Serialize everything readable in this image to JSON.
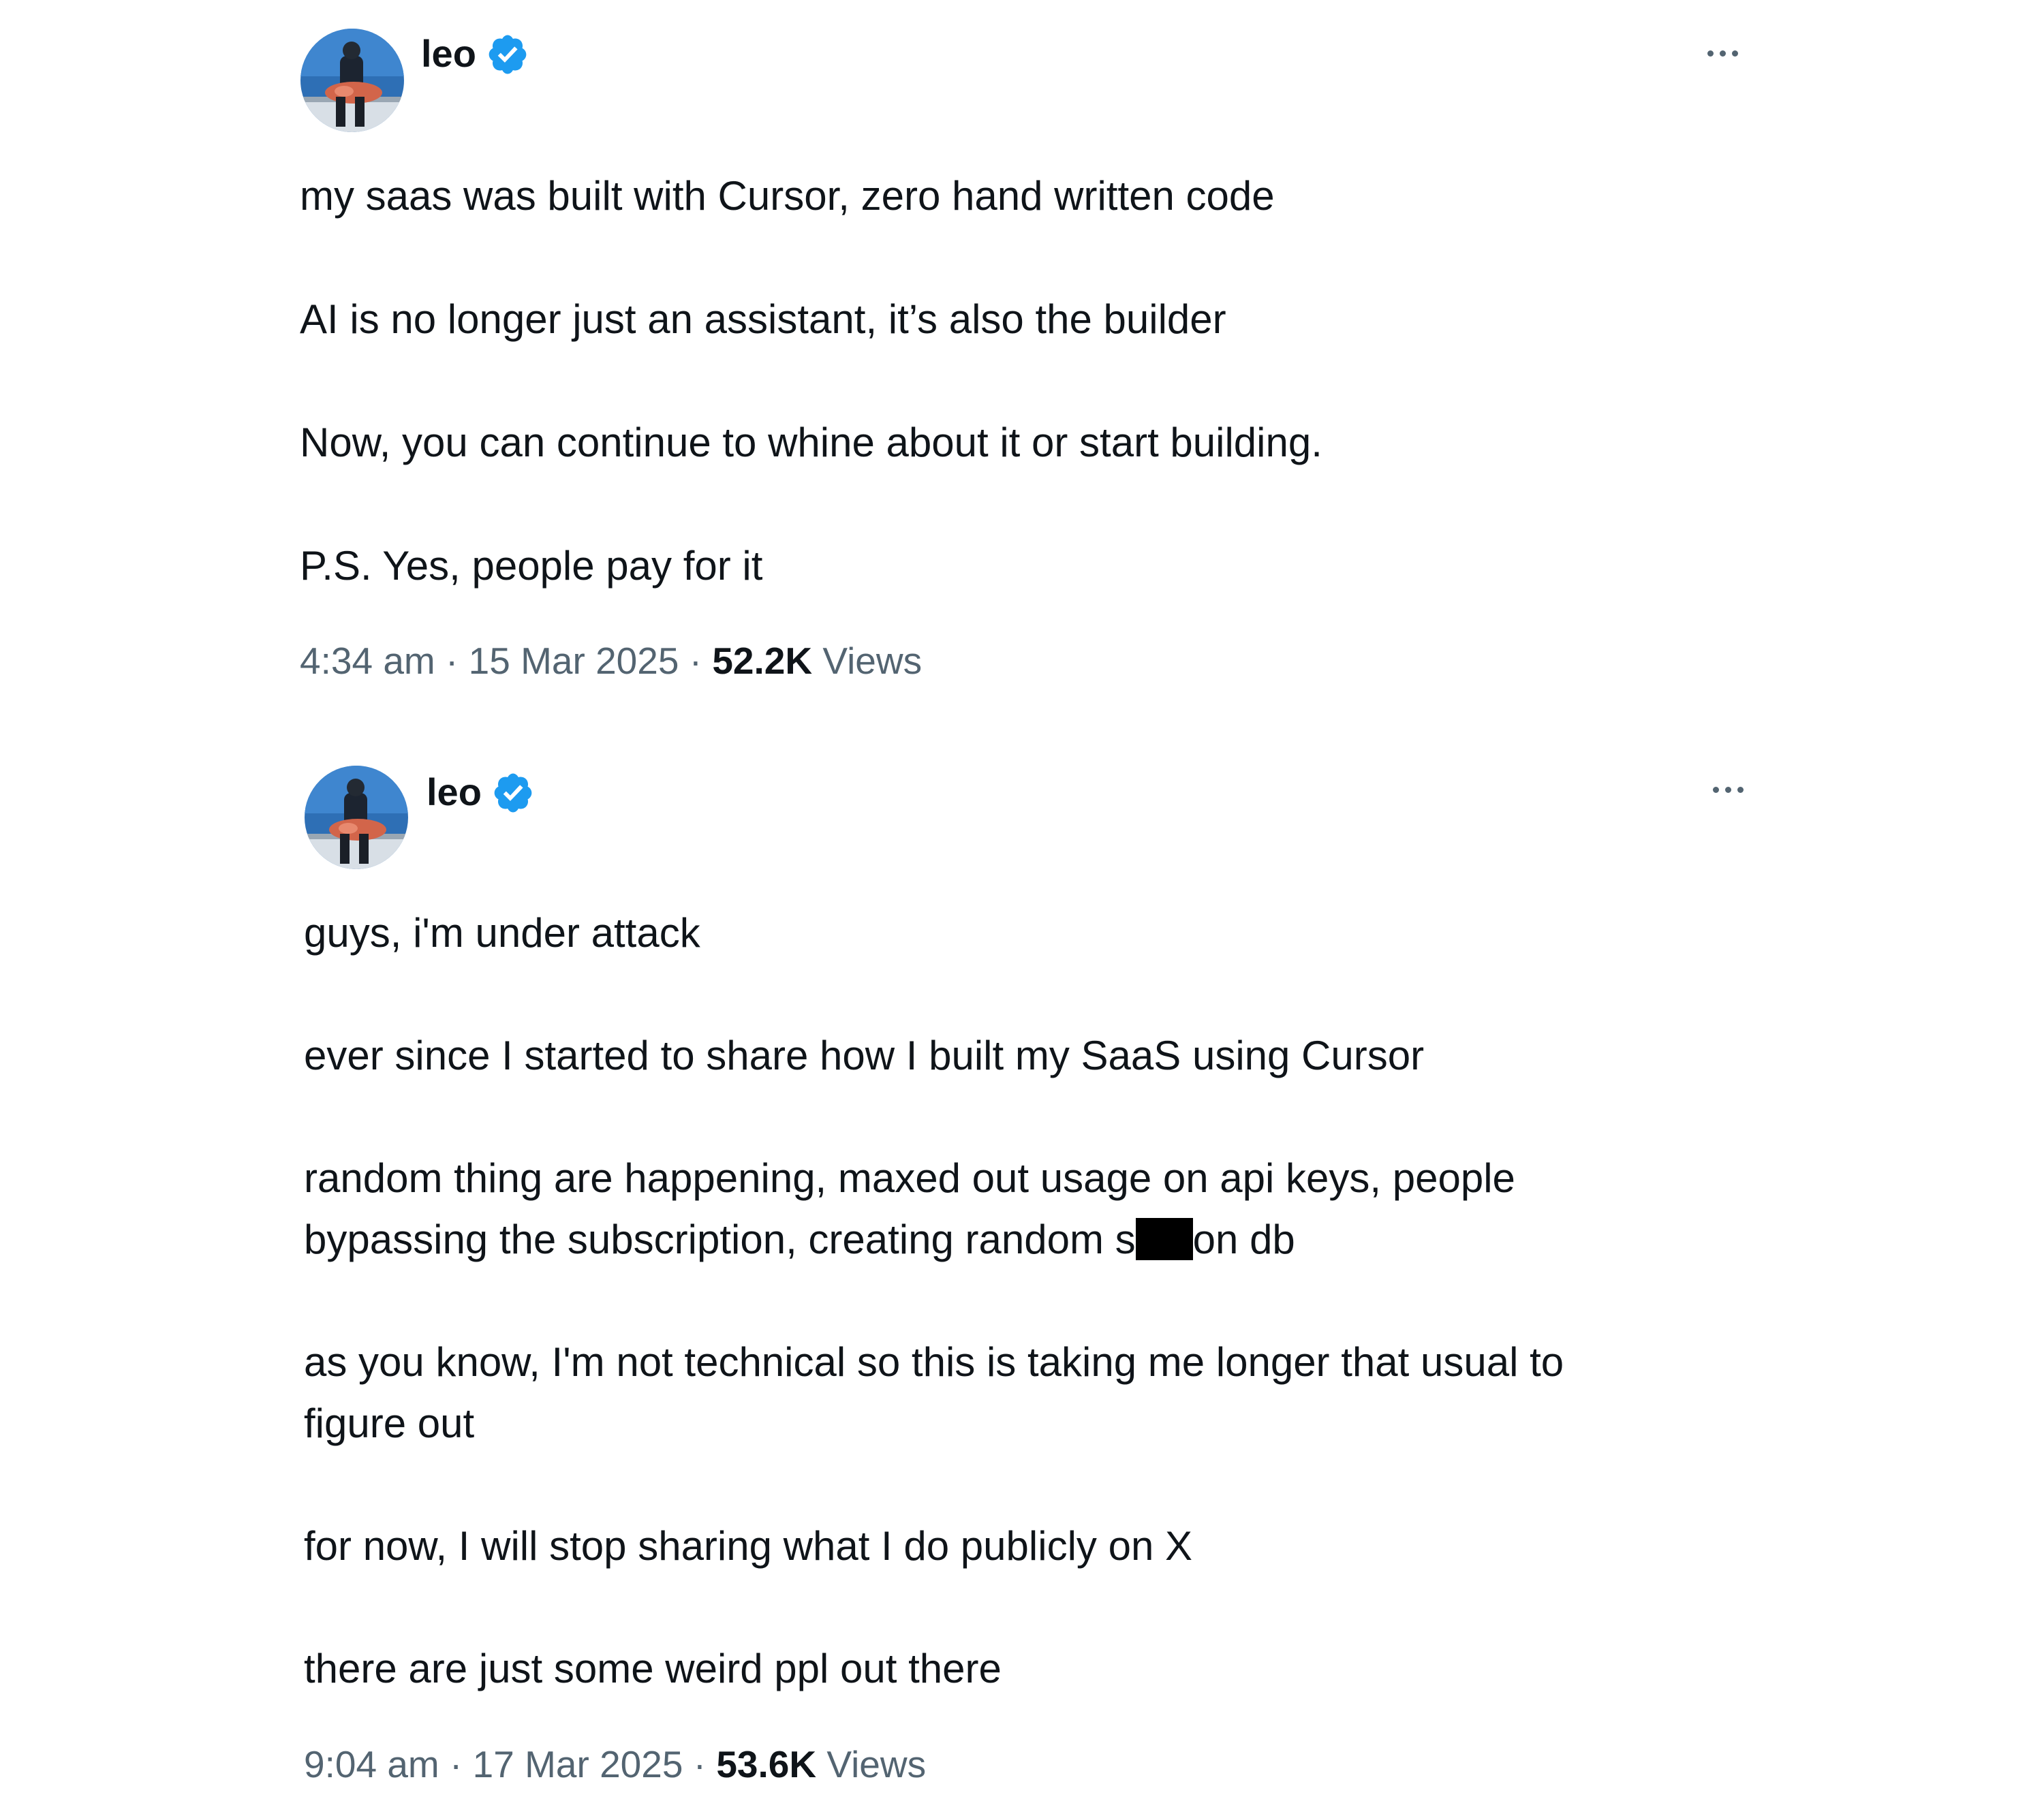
{
  "tweets": [
    {
      "author": {
        "display_name": "leo",
        "verified": true
      },
      "paragraphs": [
        "my saas was built with Cursor, zero hand written code",
        "AI is no longer just an assistant, it’s also the builder",
        "Now, you can continue to whine about it or start building.",
        "P.S. Yes, people pay for it"
      ],
      "time": "4:34 am",
      "separator": "·",
      "date": "15 Mar 2025",
      "views_count": "52.2K",
      "views_label": "Views"
    },
    {
      "author": {
        "display_name": "leo",
        "verified": true
      },
      "paragraphs": [
        "guys, i'm under attack",
        "ever since I started to share how I built my SaaS using Cursor",
        "random thing are happening, maxed out usage on api keys, people",
        "bypassing the subscription, creating random s",
        "on db",
        "as you know, I'm not technical so this is taking me longer that usual to",
        "figure out",
        "for now, I will stop sharing what I do publicly on X",
        "there are just some weird ppl out there"
      ],
      "time": "9:04 am",
      "separator": "·",
      "date": "17 Mar 2025",
      "views_count": "53.6K",
      "views_label": "Views"
    }
  ],
  "colors": {
    "text_primary": "#0f1419",
    "text_secondary": "#536471",
    "verified_badge": "#1d9bf0",
    "redaction": "#000000"
  },
  "icons": {
    "verified": "verified-badge-icon",
    "more": "more-horizontal-icon"
  }
}
